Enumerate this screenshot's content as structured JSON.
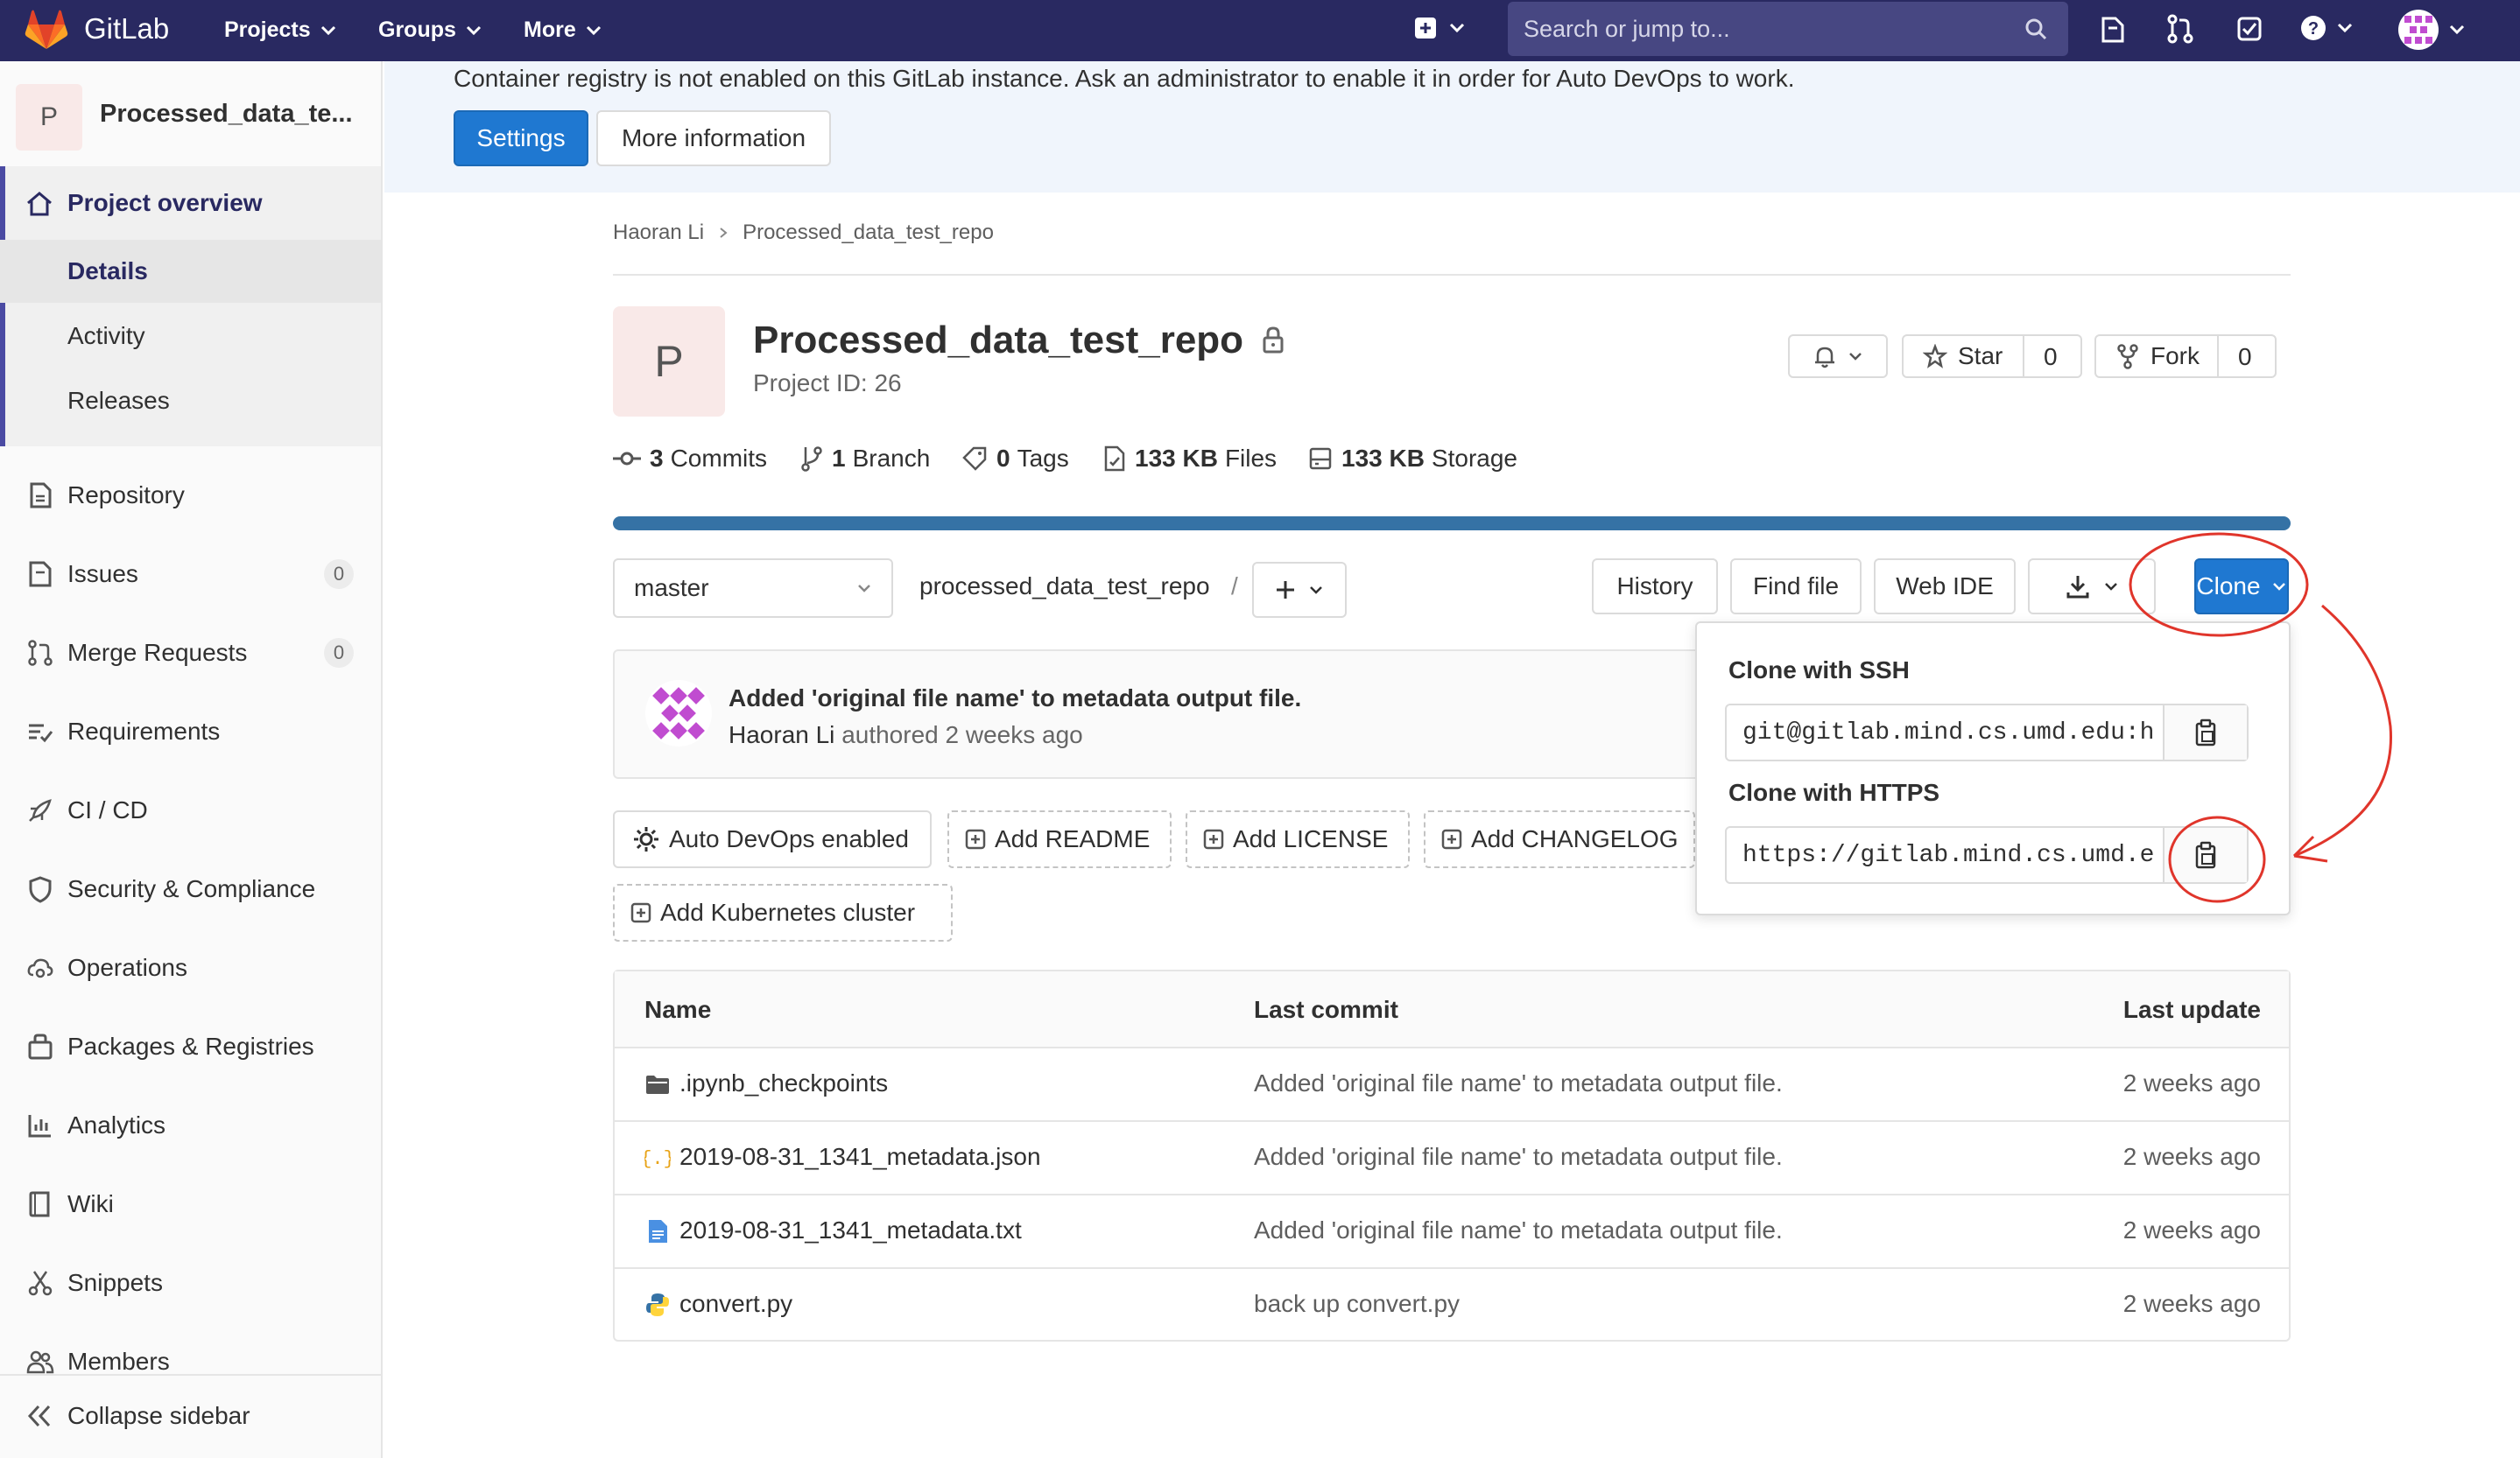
{
  "navbar": {
    "brand": "GitLab",
    "menus": [
      "Projects",
      "Groups",
      "More"
    ],
    "search_placeholder": "Search or jump to..."
  },
  "sidebar": {
    "project_avatar_letter": "P",
    "project_name": "Processed_data_te...",
    "overview_label": "Project overview",
    "overview_sub": [
      "Details",
      "Activity",
      "Releases"
    ],
    "items": [
      {
        "label": "Repository",
        "icon": "doc-icon"
      },
      {
        "label": "Issues",
        "icon": "issues-icon",
        "badge": "0"
      },
      {
        "label": "Merge Requests",
        "icon": "merge-request-icon",
        "badge": "0"
      },
      {
        "label": "Requirements",
        "icon": "requirements-icon"
      },
      {
        "label": "CI / CD",
        "icon": "rocket-icon"
      },
      {
        "label": "Security & Compliance",
        "icon": "shield-icon"
      },
      {
        "label": "Operations",
        "icon": "cloud-gear-icon"
      },
      {
        "label": "Packages & Registries",
        "icon": "package-icon"
      },
      {
        "label": "Analytics",
        "icon": "chart-icon"
      },
      {
        "label": "Wiki",
        "icon": "book-icon"
      },
      {
        "label": "Snippets",
        "icon": "scissors-icon"
      },
      {
        "label": "Members",
        "icon": "users-icon"
      }
    ],
    "collapse_label": "Collapse sidebar"
  },
  "banner": {
    "message": "Container registry is not enabled on this GitLab instance. Ask an administrator to enable it in order for Auto DevOps to work.",
    "settings_label": "Settings",
    "more_info_label": "More information"
  },
  "breadcrumb": [
    "Haoran Li",
    "Processed_data_test_repo"
  ],
  "project": {
    "avatar_letter": "P",
    "name": "Processed_data_test_repo",
    "id_text": "Project ID: 26",
    "star_label": "Star",
    "star_count": "0",
    "fork_label": "Fork",
    "fork_count": "0"
  },
  "stats": {
    "commits": {
      "bold": "3",
      "text": "Commits"
    },
    "branches": {
      "bold": "1",
      "text": "Branch"
    },
    "tags": {
      "bold": "0",
      "text": "Tags"
    },
    "files": {
      "bold": "133 KB",
      "text": "Files"
    },
    "storage": {
      "bold": "133 KB",
      "text": "Storage"
    }
  },
  "repo_bar": {
    "branch": "master",
    "path": "processed_data_test_repo",
    "separator": "/",
    "history_label": "History",
    "find_file_label": "Find file",
    "web_ide_label": "Web IDE",
    "clone_label": "Clone"
  },
  "last_commit": {
    "message": "Added 'original file name' to metadata output file.",
    "author": "Haoran Li",
    "suffix": "authored 2 weeks ago"
  },
  "quick_actions": {
    "auto_devops": "Auto DevOps enabled",
    "add_readme": "Add README",
    "add_license": "Add LICENSE",
    "add_changelog": "Add CHANGELOG",
    "add_k8s": "Add Kubernetes cluster"
  },
  "clone_menu": {
    "ssh_heading": "Clone with SSH",
    "ssh_url": "git@gitlab.mind.cs.umd.edu:h",
    "https_heading": "Clone with HTTPS",
    "https_url": "https://gitlab.mind.cs.umd.e"
  },
  "file_table": {
    "headers": [
      "Name",
      "Last commit",
      "Last update"
    ],
    "rows": [
      {
        "name": ".ipynb_checkpoints",
        "icon": "folder-icon",
        "commit": "Added 'original file name' to metadata output file.",
        "updated": "2 weeks ago"
      },
      {
        "name": "2019-08-31_1341_metadata.json",
        "icon": "json-icon",
        "commit": "Added 'original file name' to metadata output file.",
        "updated": "2 weeks ago"
      },
      {
        "name": "2019-08-31_1341_metadata.txt",
        "icon": "text-file-icon",
        "commit": "Added 'original file name' to metadata output file.",
        "updated": "2 weeks ago"
      },
      {
        "name": "convert.py",
        "icon": "python-icon",
        "commit": "back up convert.py",
        "updated": "2 weeks ago"
      }
    ]
  },
  "colors": {
    "navbar": "#292961",
    "primary": "#1f78d1",
    "annotation": "#e0352b"
  }
}
